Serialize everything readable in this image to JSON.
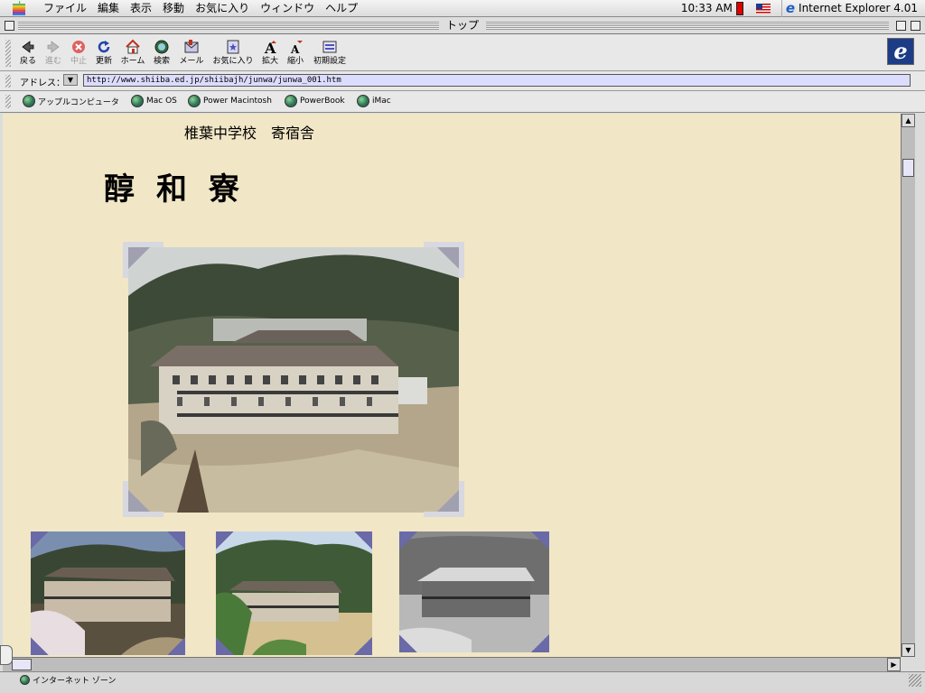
{
  "menubar": {
    "items": [
      "ファイル",
      "編集",
      "表示",
      "移動",
      "お気に入り",
      "ウィンドウ",
      "ヘルプ"
    ],
    "clock": "10:33 AM",
    "app_name": "Internet Explorer 4.01"
  },
  "window": {
    "title": "トップ"
  },
  "toolbar": {
    "back": "戻る",
    "forward": "進む",
    "stop": "中止",
    "refresh": "更新",
    "home": "ホーム",
    "search": "検索",
    "mail": "メール",
    "favorites": "お気に入り",
    "larger": "拡大",
    "smaller": "縮小",
    "preferences": "初期設定"
  },
  "address": {
    "label": "アドレス：",
    "url": "http://www.shiiba.ed.jp/shiibajh/junwa/junwa_001.htm"
  },
  "favorites_bar": [
    "アップルコンピュータ",
    "Mac OS",
    "Power Macintosh",
    "PowerBook",
    "iMac"
  ],
  "page": {
    "school_line": "椎葉中学校　寄宿舎",
    "dorm_name": "醇和寮"
  },
  "status": {
    "zone": "インターネット ゾーン"
  },
  "colors": {
    "page_bg": "#f1e6c6",
    "url_bg": "#dcdcff"
  }
}
